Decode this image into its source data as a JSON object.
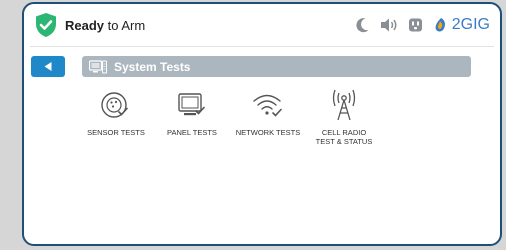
{
  "status": {
    "state_bold": "Ready",
    "state_rest": " to Arm",
    "brand": "2GIG"
  },
  "colors": {
    "accent": "#1f88c9",
    "shield": "#2bb673",
    "titlebar": "#acb6bf",
    "frame": "#1f4e79"
  },
  "header": {
    "title": "System Tests",
    "back_icon": "back-arrow-icon"
  },
  "tiles": [
    {
      "label": "SENSOR TESTS",
      "icon": "sensor-check-icon"
    },
    {
      "label": "PANEL TESTS",
      "icon": "panel-check-icon"
    },
    {
      "label": "NETWORK TESTS",
      "icon": "wifi-check-icon"
    },
    {
      "label": "CELL RADIO\nTEST & STATUS",
      "icon": "cell-radio-icon"
    }
  ]
}
